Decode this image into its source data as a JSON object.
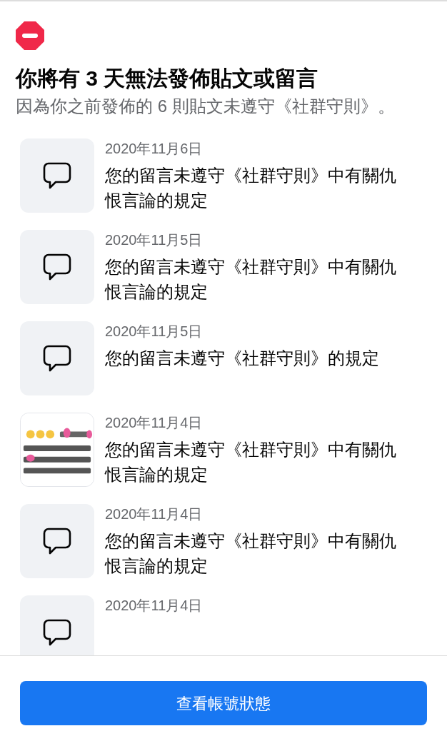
{
  "title": "你將有 3 天無法發佈貼文或留言",
  "subtitle": "因為你之前發佈的 6 則貼文未遵守《社群守則》。",
  "items": [
    {
      "kind": "comment",
      "date": "2020年11月6日",
      "message": "您的留言未遵守《社群守則》中有關仇恨言論的規定"
    },
    {
      "kind": "comment",
      "date": "2020年11月5日",
      "message": "您的留言未遵守《社群守則》中有關仇恨言論的規定"
    },
    {
      "kind": "comment",
      "date": "2020年11月5日",
      "message": "您的留言未遵守《社群守則》的規定"
    },
    {
      "kind": "picture",
      "date": "2020年11月4日",
      "message": "您的留言未遵守《社群守則》中有關仇恨言論的規定"
    },
    {
      "kind": "comment",
      "date": "2020年11月4日",
      "message": "您的留言未遵守《社群守則》中有關仇恨言論的規定"
    },
    {
      "kind": "comment",
      "date": "2020年11月4日"
    }
  ],
  "button": "查看帳號狀態"
}
